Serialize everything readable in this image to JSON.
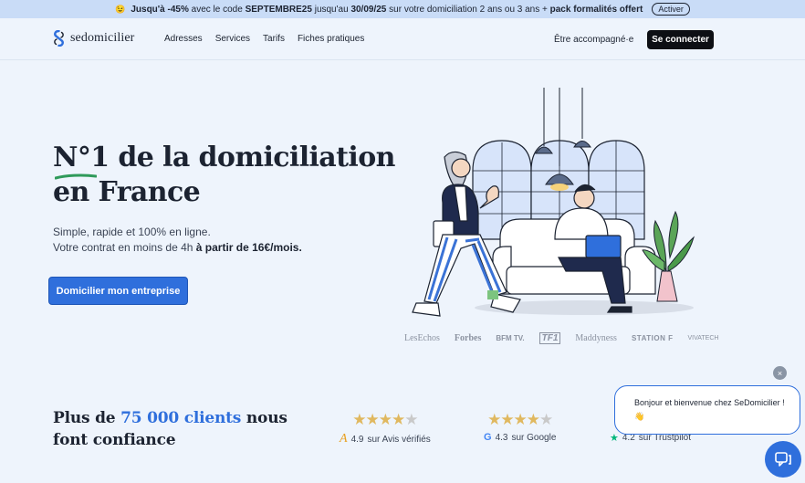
{
  "promo": {
    "emoji": "😉",
    "text_before": "Jusqu'à -45%",
    "text_mid1": " avec le code ",
    "code": "SEPTEMBRE25",
    "text_mid2": " jusqu'au ",
    "date": "30/09/25",
    "text_mid3": " sur votre domiciliation 2 ans ou 3 ans + ",
    "pack": "pack formalités offert",
    "button": "Activer"
  },
  "header": {
    "logo_text": "sedomicilier",
    "nav": [
      "Adresses",
      "Services",
      "Tarifs",
      "Fiches pratiques"
    ],
    "accompany": "Être accompagné·e",
    "login": "Se connecter"
  },
  "hero": {
    "title_line1": "N°1 de la domiciliation",
    "title_line2": "en France",
    "sub_line1": "Simple, rapide et 100% en ligne.",
    "sub_line2_plain": "Votre contrat en moins de 4h ",
    "sub_line2_bold": "à partir de 16€/mois.",
    "cta": "Domicilier mon entreprise"
  },
  "press": {
    "logos": [
      "LesEchos",
      "Forbes",
      "BFM TV.",
      "TF1",
      "Maddyness",
      "STATION F",
      "VIVATECH"
    ]
  },
  "trust": {
    "title_before": "Plus de ",
    "title_accent": "75 000 clients",
    "title_after": " nous font confiance",
    "ratings": [
      {
        "score": "4.9",
        "source": "sur Avis vérifiés",
        "icon": "avis-verifies-icon",
        "stars": 4.5
      },
      {
        "score": "4.3",
        "source": "sur Google",
        "icon": "google-icon",
        "stars": 4.5
      },
      {
        "score": "4.2",
        "source": "sur Trustpilot",
        "icon": "trustpilot-star-icon",
        "stars": 4.5
      }
    ]
  },
  "chat": {
    "message": "Bonjour et bienvenue chez SeDomicilier ! 👋",
    "close": "×"
  },
  "colors": {
    "accent": "#2f6fdc",
    "background": "#eef4fc",
    "banner": "#c9dcf7",
    "star": "#e0b85f"
  }
}
